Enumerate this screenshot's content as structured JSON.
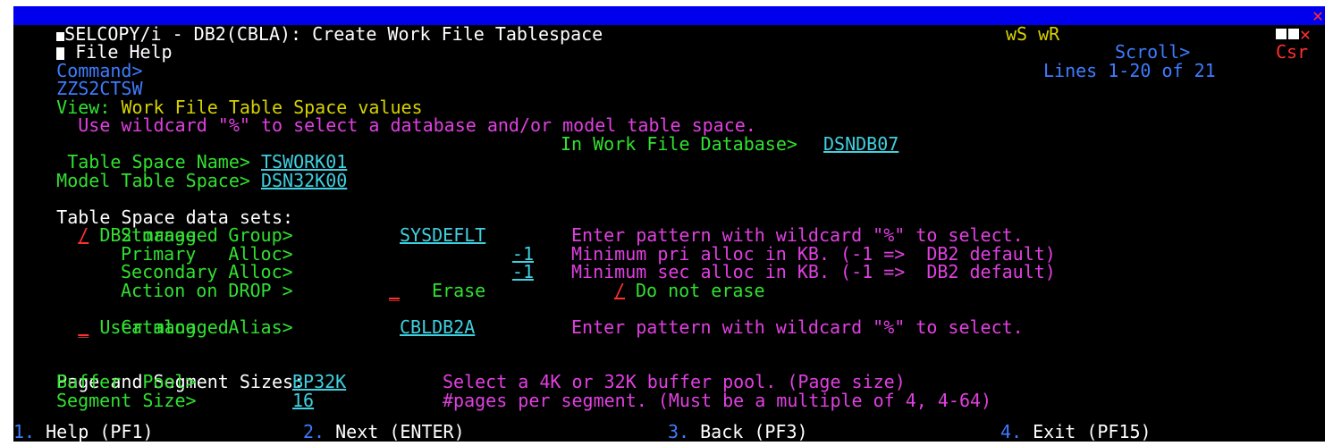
{
  "window": {
    "title": "SELCOPY/i - DB2(CBLA): Create Work File Tablespace"
  },
  "menubar": {
    "items": [
      "File",
      "Help"
    ],
    "right_indicators": "wS wR"
  },
  "command": {
    "label": "Command>",
    "value": "",
    "scroll_label": "Scroll>",
    "scroll_value": "Csr"
  },
  "panel": {
    "id": "ZZS2CTSW",
    "lines_info": "Lines 1-20 of 21",
    "view_label": "View:",
    "view_title": "Work File Table Space values",
    "instruction": "Use wildcard \"%\" to select a database and/or model table space."
  },
  "fields": {
    "tablespace_name_label": "Table Space Name>",
    "tablespace_name": "TSWORK01",
    "database_label": "In Work File Database>",
    "database": "DSNDB07",
    "model_label": "Model Table Space>",
    "model": "DSN32K00"
  },
  "datasets": {
    "heading": "Table Space data sets:",
    "db2_managed_sel": "/",
    "db2_managed_label": "DB2 managed",
    "storage_label": "Storage   Group>",
    "storage_value": "SYSDEFLT",
    "storage_help": "Enter pattern with wildcard \"%\" to select.",
    "primary_label": "Primary   Alloc>",
    "primary_value": "-1",
    "primary_help": "Minimum pri alloc in KB. (-1 =>  DB2 default)",
    "secondary_label": "Secondary Alloc>",
    "secondary_value": "-1",
    "secondary_help": "Minimum sec alloc in KB. (-1 =>  DB2 default)",
    "drop_label": "Action on DROP >",
    "erase_sel": "_",
    "erase_label": "Erase",
    "noerase_sel": "/",
    "noerase_label": "Do not erase",
    "user_managed_sel": "_",
    "user_managed_label": "User managed",
    "catalog_label": "Catalog   Alias>",
    "catalog_value": "CBLDB2A",
    "catalog_help": "Enter pattern with wildcard \"%\" to select."
  },
  "sizes": {
    "heading": "Page and Segment Sizes:",
    "bufferpool_label": "Buffer  Pool>",
    "bufferpool_value": "BP32K",
    "bufferpool_help": "Select a 4K or 32K buffer pool. (Page size)",
    "segment_label": "Segment Size>",
    "segment_value": "16",
    "segment_help": "#pages per segment. (Must be a multiple of 4, 4-64)"
  },
  "fkeys": [
    {
      "num": "1.",
      "label": "Help (PF1)"
    },
    {
      "num": "2.",
      "label": "Next (ENTER)"
    },
    {
      "num": "3.",
      "label": "Back (PF3)"
    },
    {
      "num": "4.",
      "label": "Exit (PF15)"
    }
  ],
  "colors": {
    "title_bg": "#0000ee",
    "text_blue": "#3e7cff",
    "text_green": "#31e031",
    "text_yellow": "#d6d200",
    "text_magenta": "#e040e0",
    "text_turquoise": "#40d0e0",
    "text_red": "#ff3030"
  }
}
